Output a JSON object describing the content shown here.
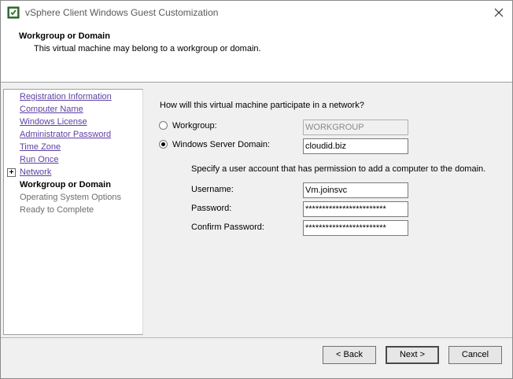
{
  "window": {
    "title": "vSphere Client Windows Guest Customization"
  },
  "header": {
    "title": "Workgroup or Domain",
    "description": "This virtual machine may belong to a workgroup or domain."
  },
  "nav": {
    "items": [
      {
        "label": "Registration Information",
        "state": "link"
      },
      {
        "label": "Computer Name",
        "state": "link"
      },
      {
        "label": "Windows License",
        "state": "link"
      },
      {
        "label": "Administrator Password",
        "state": "link"
      },
      {
        "label": "Time Zone",
        "state": "link"
      },
      {
        "label": "Run Once",
        "state": "link"
      },
      {
        "label": "Network",
        "state": "link",
        "expander": "+"
      },
      {
        "label": "Workgroup or Domain",
        "state": "current"
      },
      {
        "label": "Operating System Options",
        "state": "disabled"
      },
      {
        "label": "Ready to Complete",
        "state": "disabled"
      }
    ]
  },
  "content": {
    "question": "How will this virtual machine participate in a network?",
    "workgroup": {
      "label": "Workgroup:",
      "value": "WORKGROUP",
      "selected": false
    },
    "domain": {
      "label": "Windows Server Domain:",
      "value": "cloudid.biz",
      "selected": true
    },
    "permission_text": "Specify a user account that has permission to add a computer to the domain.",
    "username": {
      "label": "Username:",
      "value": "Vm.joinsvc"
    },
    "password": {
      "label": "Password:",
      "value": "************************"
    },
    "confirm_password": {
      "label": "Confirm Password:",
      "value": "************************"
    }
  },
  "footer": {
    "back_label": "< Back",
    "next_label": "Next >",
    "cancel_label": "Cancel"
  }
}
